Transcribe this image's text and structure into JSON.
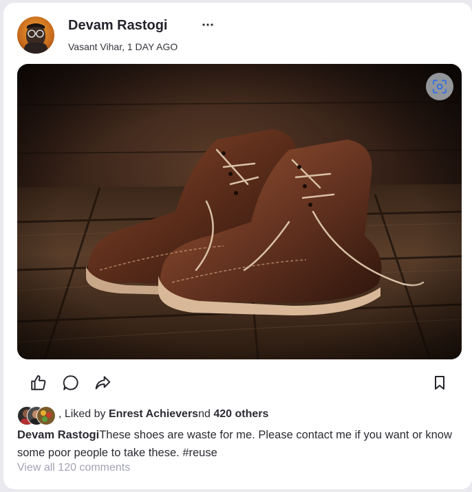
{
  "post": {
    "author_name": "Devam Rastogi",
    "location_time": "Vasant Vihar, 1 DAY AGO",
    "more_glyph": "···",
    "image_alt": "pair of old brown leather boots on wooden planks"
  },
  "actions": {
    "like_icon": "thumbs-up-icon",
    "comment_icon": "comment-icon",
    "share_icon": "share-icon",
    "save_icon": "bookmark-icon",
    "scan_icon": "scan-icon"
  },
  "engagement": {
    "liked_prefix": ", Liked by ",
    "liked_by_name": "Enrest Achievers",
    "liked_mid": "nd ",
    "others_count": "420 others"
  },
  "caption": {
    "author": "Devam Rastogi",
    "text": "These shoes are waste for me. Please contact me if you want or know some poor people to take these. #reuse"
  },
  "comments": {
    "view_all_label": "View all 120 comments"
  },
  "colors": {
    "text_primary": "#23232b",
    "muted": "#a2a2b5",
    "background": "#e9e9ef",
    "card": "#ffffff"
  }
}
